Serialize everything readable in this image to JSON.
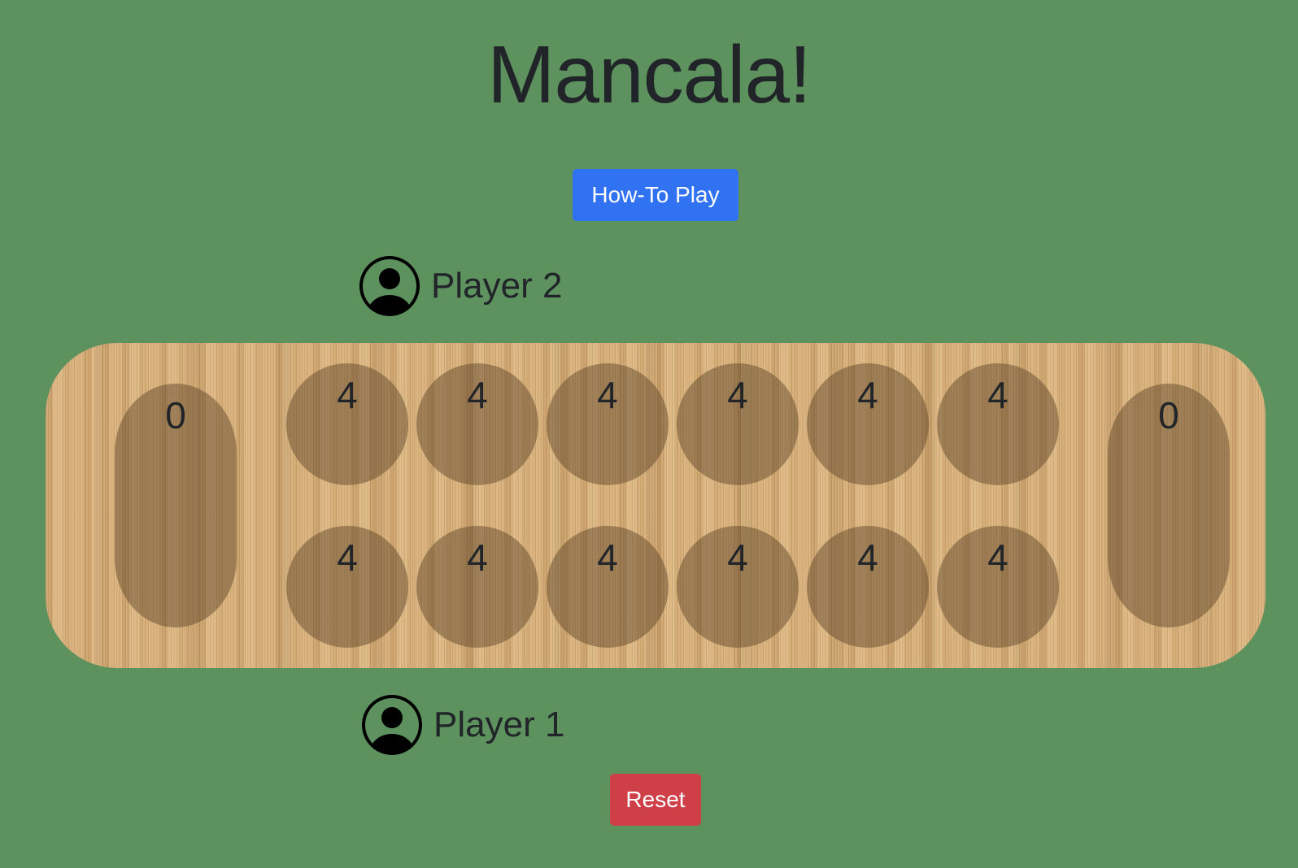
{
  "title": "Mancala!",
  "buttons": {
    "howto_label": "How-To Play",
    "reset_label": "Reset"
  },
  "players": {
    "top": {
      "name": "Player 2",
      "icon": "person-circle-icon"
    },
    "bottom": {
      "name": "Player 1",
      "icon": "person-circle-icon"
    }
  },
  "board": {
    "stores": {
      "left": "0",
      "right": "0"
    },
    "top_pits": [
      "4",
      "4",
      "4",
      "4",
      "4",
      "4"
    ],
    "bottom_pits": [
      "4",
      "4",
      "4",
      "4",
      "4",
      "4"
    ]
  },
  "colors": {
    "background": "#5d915d",
    "howto_button": "#3072f2",
    "reset_button": "#cf3f48",
    "board_wood": "#d9b27e"
  }
}
